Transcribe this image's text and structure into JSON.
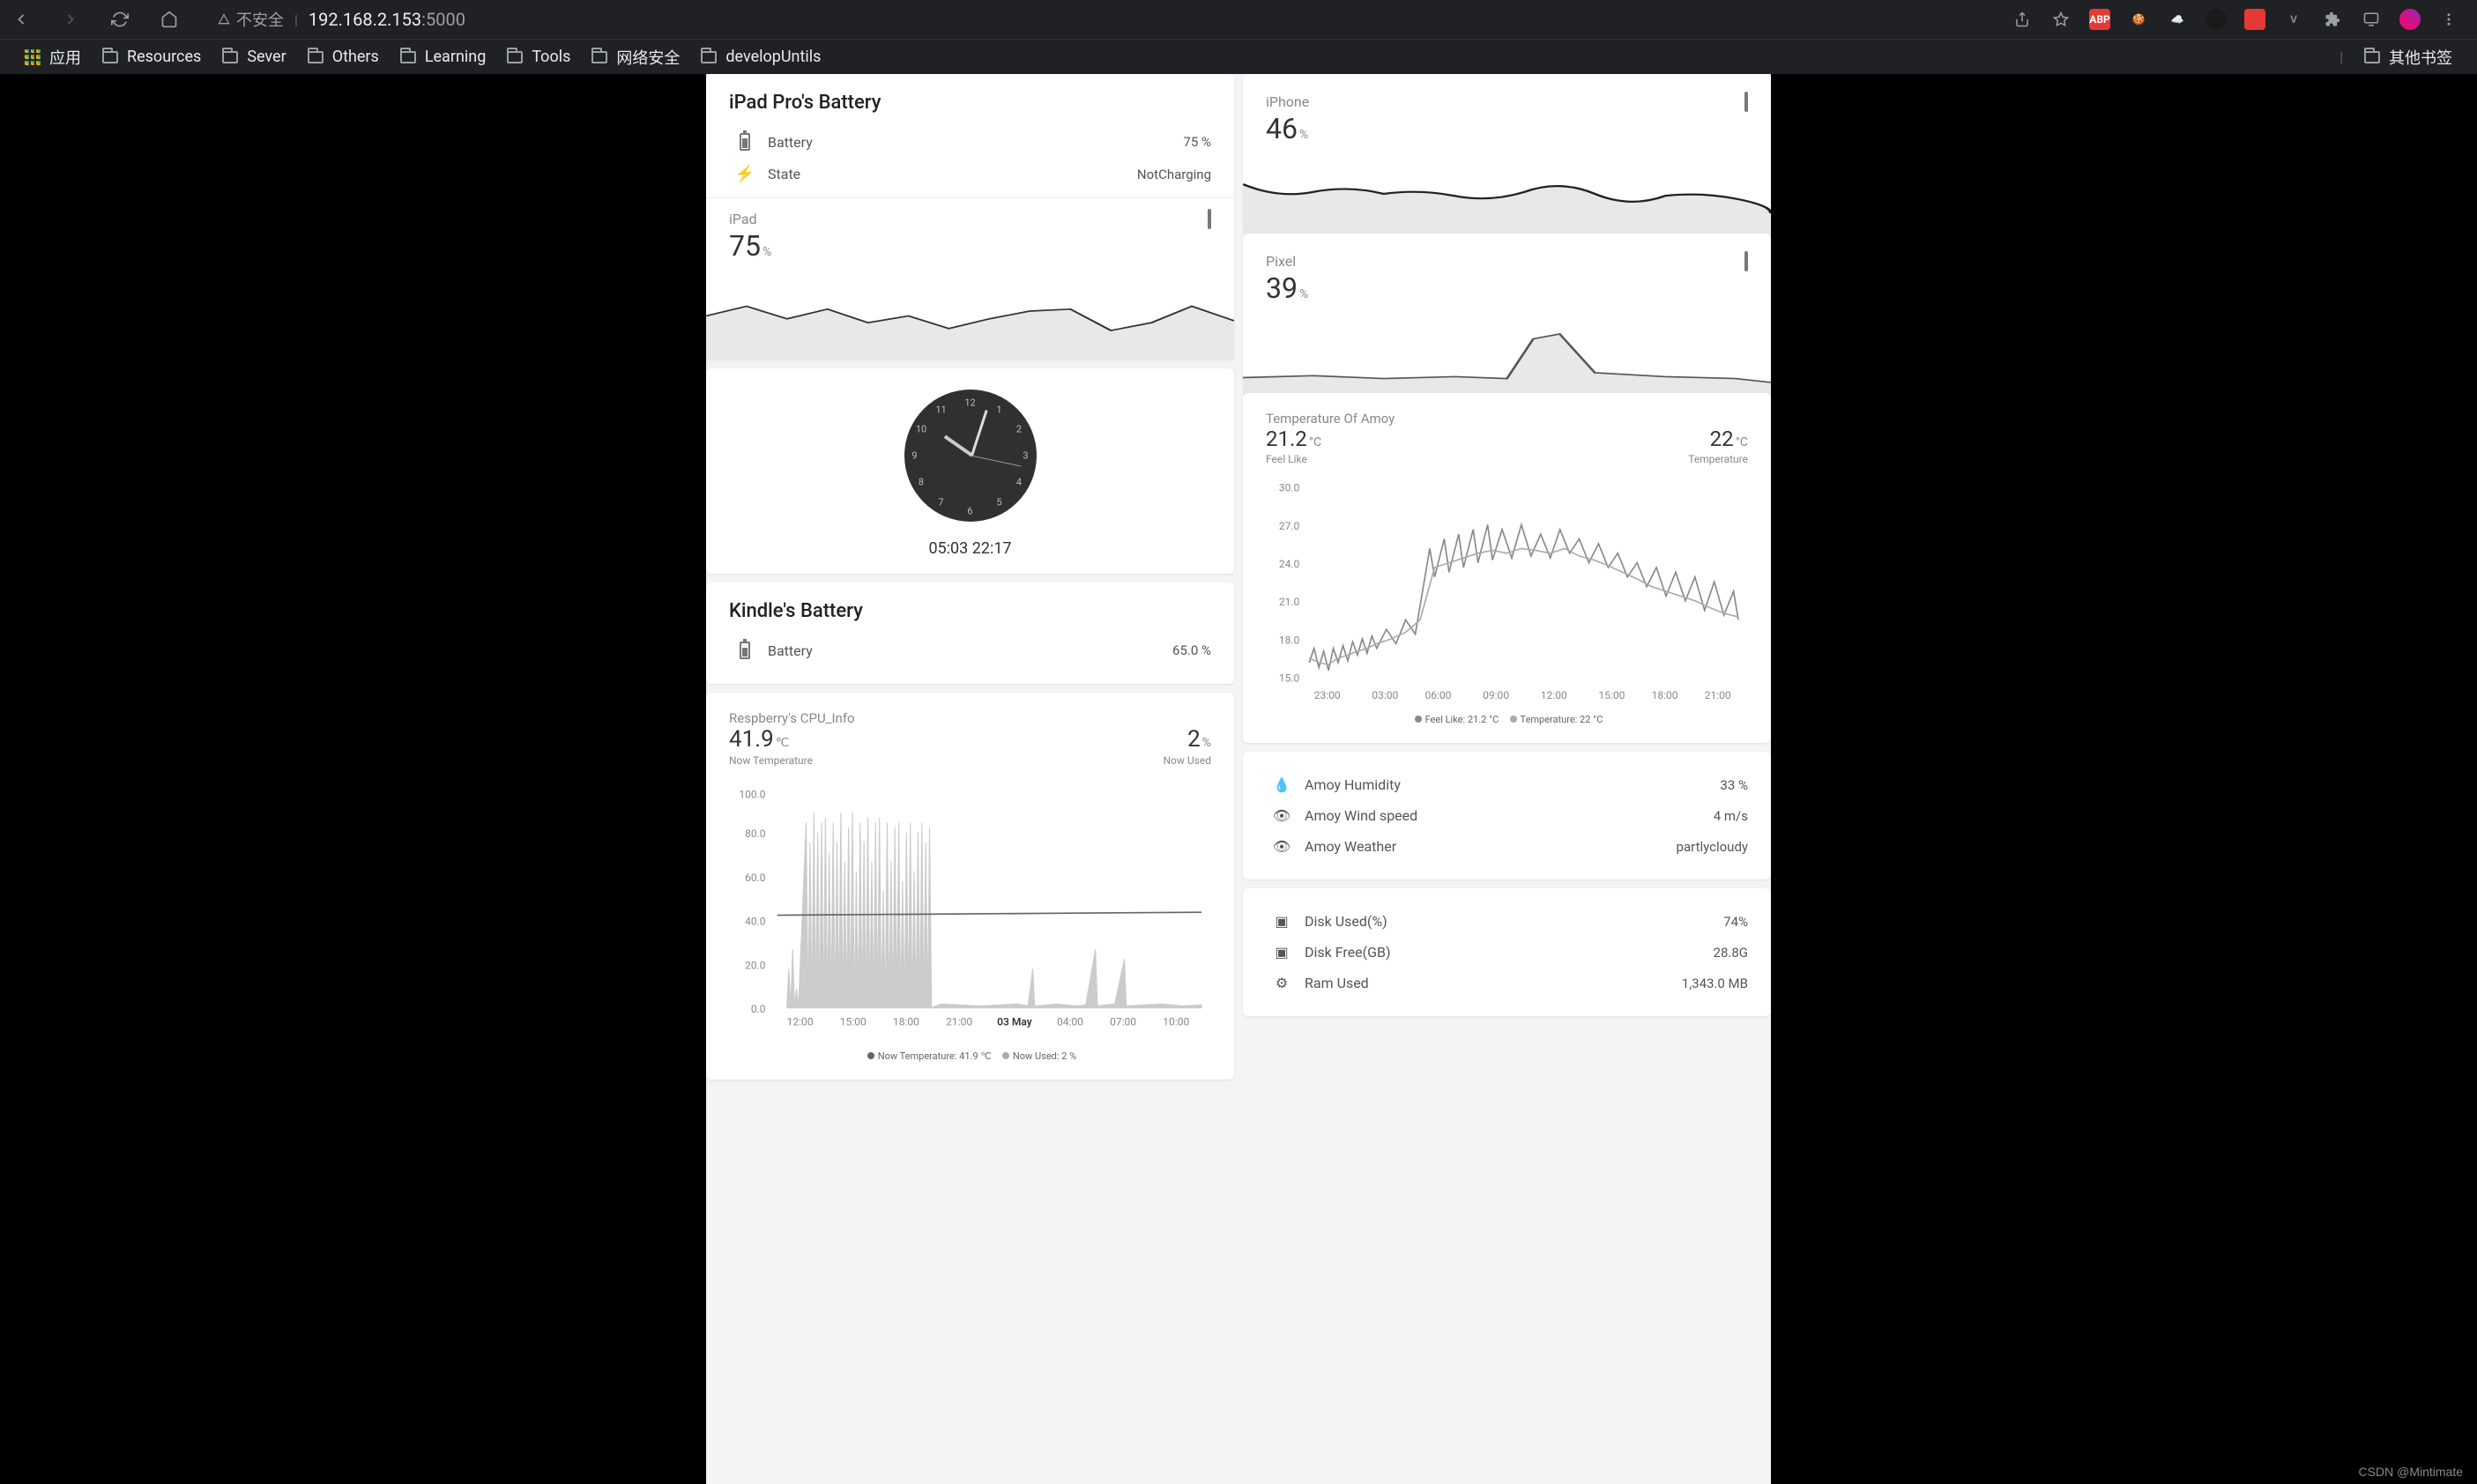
{
  "browser": {
    "url_host": "192.168.2.153",
    "url_port": ":5000",
    "security_label": "不安全",
    "apps_label": "应用",
    "other_bookmarks": "其他书签",
    "bookmarks": [
      "Resources",
      "Sever",
      "Others",
      "Learning",
      "Tools",
      "网络安全",
      "developUntils"
    ]
  },
  "ipad_pro": {
    "title": "iPad Pro's Battery",
    "rows": [
      {
        "icon": "battery",
        "label": "Battery",
        "value": "75 %"
      },
      {
        "icon": "bolt",
        "label": "State",
        "value": "NotCharging"
      }
    ]
  },
  "ipad_spark": {
    "name": "iPad",
    "value": "75",
    "unit": "%",
    "points": [
      55,
      45,
      58,
      48,
      62,
      55,
      68,
      58,
      50,
      48,
      70,
      62,
      45,
      60
    ]
  },
  "iphone_spark": {
    "name": "iPhone",
    "value": "46",
    "unit": "%",
    "points": [
      80,
      60,
      55,
      68,
      60,
      72,
      62,
      78,
      65,
      55,
      80,
      68,
      75,
      90
    ]
  },
  "pixel_spark": {
    "name": "Pixel",
    "value": "39",
    "unit": "%",
    "points": [
      88,
      85,
      86,
      88,
      86,
      88,
      85,
      88,
      40,
      38,
      82,
      84,
      86,
      90
    ]
  },
  "clock": {
    "time": "05:03 22:17"
  },
  "kindle": {
    "title": "Kindle's Battery",
    "rows": [
      {
        "icon": "battery",
        "label": "Battery",
        "value": "65.0 %"
      }
    ]
  },
  "cpu": {
    "title": "Respberry's CPU_Info",
    "left_value": "41.9",
    "left_unit": "℃",
    "left_sub": "Now Temperature",
    "right_value": "2",
    "right_unit": "%",
    "right_sub": "Now Used",
    "legend_a": "Now Temperature: 41.9 ℃",
    "legend_b": "Now Used: 2 %",
    "x_ticks": [
      "12:00",
      "15:00",
      "18:00",
      "21:00",
      "03 May",
      "04:00",
      "07:00",
      "10:00"
    ],
    "y_ticks": [
      "0.0",
      "20.0",
      "40.0",
      "60.0",
      "80.0",
      "100.0"
    ]
  },
  "temp_amoy": {
    "title": "Temperature Of Amoy",
    "left_value": "21.2",
    "left_unit": "°C",
    "left_sub": "Feel Like",
    "right_value": "22",
    "right_unit": "°C",
    "right_sub": "Temperature",
    "legend_a": "Feel Like: 21.2 °C",
    "legend_b": "Temperature: 22 °C",
    "x_ticks": [
      "23:00",
      "03:00",
      "06:00",
      "09:00",
      "12:00",
      "15:00",
      "18:00",
      "21:00"
    ],
    "y_ticks": [
      "15.0",
      "18.0",
      "21.0",
      "24.0",
      "27.0",
      "30.0"
    ]
  },
  "weather_rows": [
    {
      "icon": "humidity",
      "label": "Amoy Humidity",
      "value": "33 %"
    },
    {
      "icon": "eye",
      "label": "Amoy Wind speed",
      "value": "4 m/s"
    },
    {
      "icon": "eye",
      "label": "Amoy Weather",
      "value": "partlycloudy"
    }
  ],
  "sys_rows": [
    {
      "icon": "disk",
      "label": "Disk Used(%)",
      "value": "74%"
    },
    {
      "icon": "disk",
      "label": "Disk Free(GB)",
      "value": "28.8G"
    },
    {
      "icon": "gear",
      "label": "Ram Used",
      "value": "1,343.0 MB"
    }
  ],
  "chart_data": [
    {
      "type": "area",
      "name": "iPad",
      "x": null,
      "values": [
        55,
        45,
        58,
        48,
        62,
        55,
        68,
        58,
        50,
        48,
        70,
        62,
        45,
        60
      ],
      "ylim": [
        0,
        100
      ]
    },
    {
      "type": "area",
      "name": "iPhone",
      "x": null,
      "values": [
        80,
        60,
        55,
        68,
        60,
        72,
        62,
        78,
        65,
        55,
        80,
        68,
        75,
        90
      ],
      "ylim": [
        0,
        100
      ]
    },
    {
      "type": "area",
      "name": "Pixel",
      "x": null,
      "values": [
        88,
        85,
        86,
        88,
        86,
        88,
        85,
        88,
        40,
        38,
        82,
        84,
        86,
        90
      ],
      "ylim": [
        0,
        100
      ]
    },
    {
      "type": "line",
      "name": "Temperature Of Amoy",
      "title": "Temperature Of Amoy",
      "x": [
        "23:00",
        "03:00",
        "06:00",
        "09:00",
        "12:00",
        "15:00",
        "18:00",
        "21:00"
      ],
      "series": [
        {
          "name": "Feel Like",
          "values": [
            17,
            16,
            17,
            18,
            17,
            18,
            18,
            19,
            18,
            25,
            24,
            26,
            24,
            27,
            25,
            26,
            24,
            26,
            22,
            24,
            21,
            23,
            20,
            22
          ]
        },
        {
          "name": "Temperature",
          "values": [
            18,
            17,
            18,
            19,
            18,
            19,
            19,
            20,
            19,
            26,
            25,
            27,
            25,
            27,
            26,
            27,
            25,
            27,
            23,
            25,
            22,
            24,
            21,
            23
          ]
        }
      ],
      "ylim": [
        15,
        30
      ],
      "xlabel": "",
      "ylabel": ""
    },
    {
      "type": "line",
      "name": "Respberry CPU",
      "title": "Respberry's CPU_Info",
      "x": [
        "12:00",
        "15:00",
        "18:00",
        "21:00",
        "03 May",
        "04:00",
        "07:00",
        "10:00"
      ],
      "series": [
        {
          "name": "Now Temperature",
          "values": [
            42,
            42,
            43,
            42,
            43,
            42,
            42,
            42,
            42,
            42,
            42,
            42,
            42,
            42,
            42,
            42
          ]
        },
        {
          "name": "Now Used",
          "values": [
            8,
            15,
            95,
            70,
            98,
            60,
            90,
            45,
            5,
            4,
            6,
            5,
            20,
            5,
            6,
            5
          ]
        }
      ],
      "ylim": [
        0,
        100
      ],
      "xlabel": "",
      "ylabel": ""
    }
  ],
  "watermark": "CSDN @Mintimate"
}
